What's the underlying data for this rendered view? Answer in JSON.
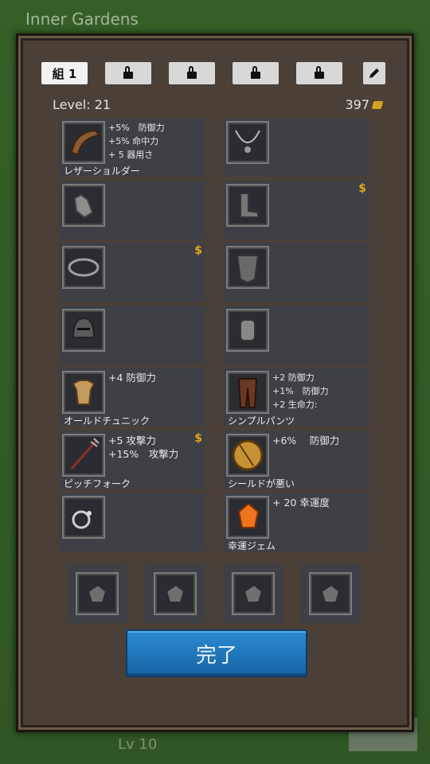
{
  "world": {
    "title": "Inner Gardens",
    "footer": "Lv 10"
  },
  "tabs": [
    {
      "label": "組 1",
      "active": true
    },
    {
      "label": "",
      "locked": true
    },
    {
      "label": "",
      "locked": true
    },
    {
      "label": "",
      "locked": true
    },
    {
      "label": "",
      "locked": true
    }
  ],
  "header": {
    "level_label": "Level:",
    "level_value": "21",
    "gold": "397"
  },
  "slots": [
    {
      "stats": "+5%　防御力\n+5% 命中力\n+ 5 器用さ",
      "name": "レザーショルダー",
      "icon": "shoulder-icon"
    },
    {
      "stats": "",
      "name": "",
      "icon": "necklace-icon"
    },
    {
      "stats": "",
      "name": "",
      "icon": "gloves-icon"
    },
    {
      "stats": "",
      "name": "",
      "icon": "boots-icon",
      "premium": "$"
    },
    {
      "stats": "",
      "name": "",
      "icon": "belt-icon",
      "premium": "$"
    },
    {
      "stats": "",
      "name": "",
      "icon": "cape-icon"
    },
    {
      "stats": "",
      "name": "",
      "icon": "helmet-icon"
    },
    {
      "stats": "",
      "name": "",
      "icon": "bracer-icon"
    },
    {
      "stats": "+4 防御力",
      "name": "オールドチュニック",
      "icon": "tunic-icon"
    },
    {
      "stats": "+2 防御力\n+1%　防御力\n+2 生命力:",
      "name": "シンプルパンツ",
      "icon": "pants-icon"
    },
    {
      "stats": "+5 攻撃力\n+15%　攻撃力",
      "name": "ピッチフォーク",
      "icon": "pitchfork-icon",
      "premium": "$"
    },
    {
      "stats": "+6%　 防御力",
      "name": "シールドが悪い",
      "icon": "shield-icon"
    },
    {
      "stats": "",
      "name": "",
      "icon": "ring-icon"
    },
    {
      "stats": "+ 20 幸運度",
      "name": "幸運ジェム",
      "icon": "gem-icon"
    }
  ],
  "gem_slots": [
    "empty-gem-icon",
    "empty-gem-icon",
    "empty-gem-icon",
    "empty-gem-icon"
  ],
  "done_button": "完了",
  "colors": {
    "accent": "#1e74bd",
    "premium": "#e3a51a",
    "slot_bg": "#3f4046"
  }
}
